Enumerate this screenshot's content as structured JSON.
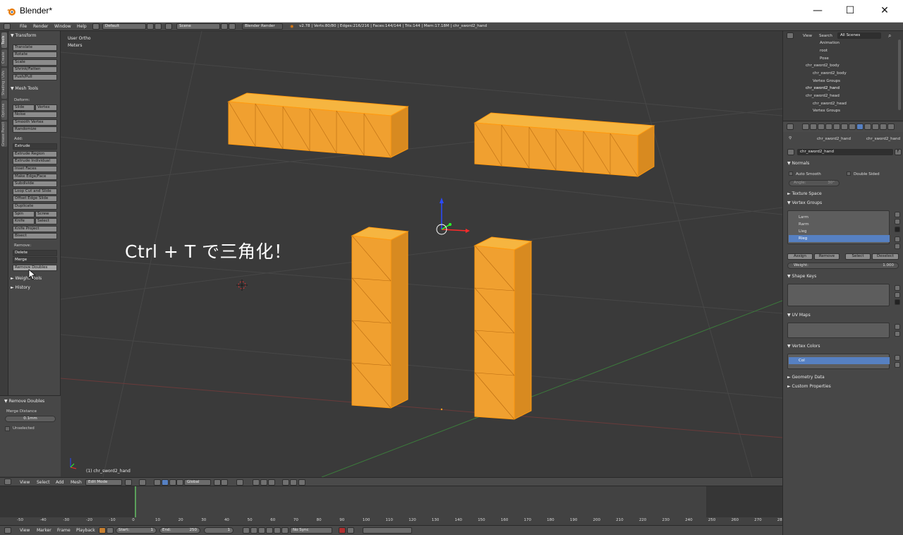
{
  "window": {
    "title": "Blender*",
    "minimize": "—",
    "maximize": "☐",
    "close": "✕"
  },
  "menubar": {
    "items": [
      "File",
      "Render",
      "Window",
      "Help"
    ],
    "screen_layout": "Default",
    "scene": "Scene",
    "engine": "Blender Render",
    "stats": "v2.78 | Verts:80/80 | Edges:216/216 | Faces:144/144 | Tris:144 | Mem:17.18M | chr_sword2_hand"
  },
  "left_tabs": [
    "Tools",
    "Create",
    "Shading / UVs",
    "Options",
    "Grease Pencil"
  ],
  "toolshelf": {
    "transform_header": "Transform",
    "transform": [
      "Translate",
      "Rotate",
      "Scale",
      "Shrink/Fatten",
      "Push/Pull"
    ],
    "mesh_tools_header": "Mesh Tools",
    "deform_label": "Deform:",
    "slide_edge": "Slide Edge",
    "vertex": "Vertex",
    "deform": [
      "Noise",
      "Smooth Vertex",
      "Randomize"
    ],
    "add_label": "Add:",
    "extrude": "Extrude",
    "add": [
      "Extrude Region",
      "Extrude Individual",
      "Inset Faces",
      "Make Edge/Face",
      "Subdivide",
      "Loop Cut and Slide",
      "Offset Edge Slide",
      "Duplicate"
    ],
    "spin": "Spin",
    "screw": "Screw",
    "knife": "Knife",
    "select": "Select",
    "knife_project": "Knife Project",
    "bisect": "Bisect",
    "remove_label": "Remove:",
    "delete": "Delete",
    "merge": "Merge",
    "remove_doubles": "Remove Doubles",
    "weight_tools": "Weight Tools",
    "history": "History"
  },
  "redo_panel": {
    "header": "Remove Doubles",
    "merge_distance_label": "Merge Distance",
    "merge_distance": "0.1mm",
    "unselected": "Unselected"
  },
  "viewport": {
    "view_label": "User Ortho",
    "units": "Meters",
    "object_label": "(1) chr_sword2_hand",
    "annotation": "Ctrl + T で三角化！"
  },
  "outliner": {
    "view": "View",
    "search": "Search",
    "filter": "All Scenes",
    "items": [
      "Animation",
      "root",
      "Pose",
      "chr_sword2_body",
      "chr_sword2_body",
      "Vertex Groups",
      "chr_sword2_hand",
      "chr_sword2_head",
      "chr_sword2_head",
      "Vertex Groups"
    ]
  },
  "properties": {
    "breadcrumb_a": "chr_sword2_hand",
    "breadcrumb_b": "chr_sword2_hand",
    "mesh_name": "chr_sword2_hand",
    "fake_user": "F",
    "normals": "Normals",
    "auto_smooth": "Auto Smooth",
    "double_sided": "Double Sided",
    "angle_label": "Angle:",
    "angle_value": "30°",
    "texture_space": "Texture Space",
    "vertex_groups": "Vertex Groups",
    "groups": [
      "Larm",
      "Rarm",
      "Lleg",
      "Rleg"
    ],
    "assign": "Assign",
    "remove": "Remove",
    "select": "Select",
    "deselect": "Deselect",
    "weight_label": "Weight:",
    "weight_value": "1.000",
    "shape_keys": "Shape Keys",
    "uv_maps": "UV Maps",
    "vertex_colors": "Vertex Colors",
    "vc_item": "Col",
    "geometry_data": "Geometry Data",
    "custom_properties": "Custom Properties"
  },
  "header3d": {
    "menus": [
      "View",
      "Select",
      "Add",
      "Mesh"
    ],
    "mode": "Edit Mode",
    "orientation": "Global"
  },
  "timeline": {
    "ticks": [
      "-50",
      "-40",
      "-30",
      "-20",
      "-10",
      "0",
      "10",
      "20",
      "30",
      "40",
      "50",
      "60",
      "70",
      "80",
      "90",
      "100",
      "110",
      "120",
      "130",
      "140",
      "150",
      "160",
      "170",
      "180",
      "190",
      "200",
      "210",
      "220",
      "230",
      "240",
      "250",
      "260",
      "270",
      "280"
    ],
    "menus": [
      "View",
      "Marker",
      "Frame",
      "Playback"
    ],
    "start_label": "Start:",
    "start": "1",
    "end_label": "End:",
    "end": "250",
    "current": "1",
    "sync": "No Sync"
  },
  "colors": {
    "accent": "#f5a020",
    "selection": "#5680c2",
    "bg_view": "#3a3a3a"
  }
}
